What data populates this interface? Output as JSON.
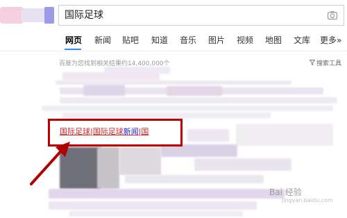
{
  "search": {
    "query": "国际足球",
    "camera_icon": "camera-icon"
  },
  "tabs": [
    "网页",
    "新闻",
    "贴吧",
    "知道",
    "音乐",
    "图片",
    "视频",
    "地图",
    "文库",
    "更多»"
  ],
  "active_tab": "网页",
  "results_info": "百度为您找到相关结果约14,400,000个",
  "search_tools": "搜索工具",
  "search_tools_icon": "filter-icon",
  "highlighted_result": {
    "part1": "国际足球|国际足球",
    "part2": "新闻",
    "part3": "|国"
  },
  "colors": {
    "highlight_box": "#c00000",
    "arrow": "#b00000",
    "active_tab_underline": "#3388ff",
    "link": "#cc2222"
  },
  "watermark": {
    "text": "Bai 经验",
    "sub": "jingyan.baidu.com"
  }
}
